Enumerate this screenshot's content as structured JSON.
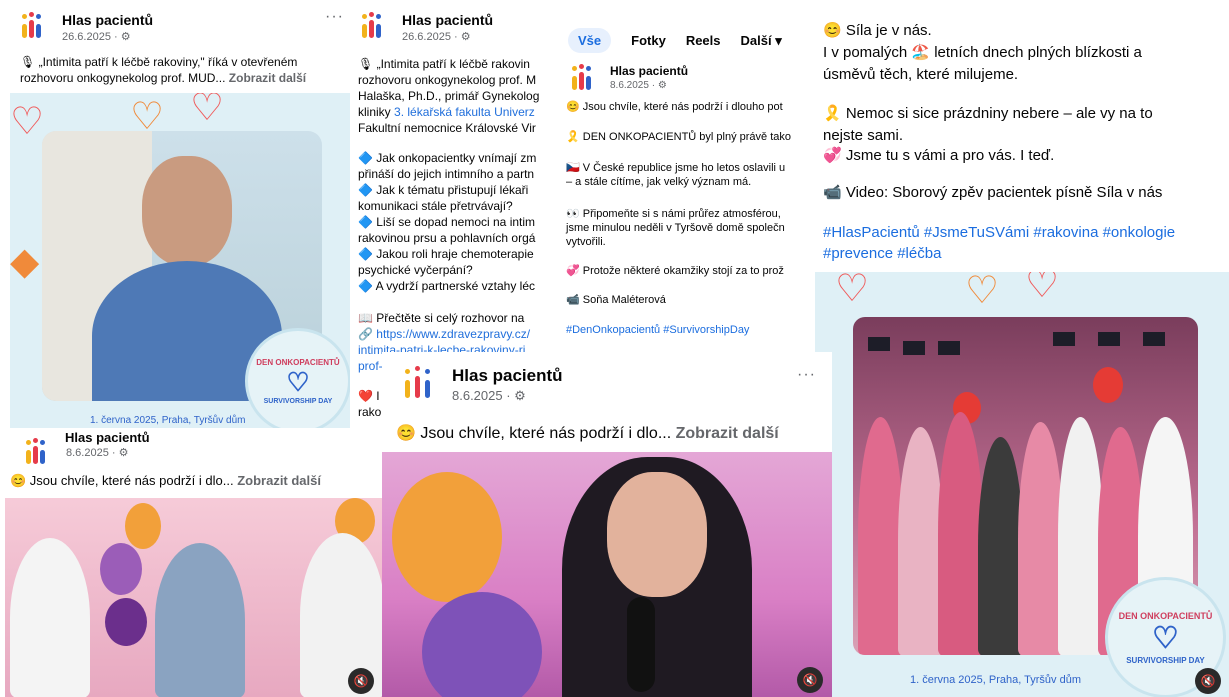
{
  "page_name": "Hlas pacientů",
  "posts": [
    {
      "date": "26.6.2025 · ⚙",
      "line1": "🎙 „Intimita patří k léčbě rakoviny,\" říká v otevřeném",
      "line2": "rozhovoru onkogynekolog prof. MUD...",
      "more": "Zobrazit další",
      "badge_top": "DEN ONKOPACIENTŮ",
      "badge_bottom": "SURVIVORSHIP DAY",
      "caption": "1. června 2025, Praha, Tyršův dům"
    },
    {
      "date": "26.6.2025 · ⚙",
      "lines": [
        "🎙 „Intimita patří k léčbě rakovin",
        "rozhovoru onkogynekolog prof. M",
        "Halaška, Ph.D., primář Gynekolog"
      ],
      "line4_prefix": "kliniky ",
      "line4_link": "3. lékařská fakulta Univerz",
      "line5": "Fakultní nemocnice Královské Vir",
      "bullets": [
        "🔷 Jak onkopacientky vnímají zm",
        "přináší do jejich intimního a partn",
        "🔷 Jak k tématu přistupují lékaři",
        "komunikaci stále přetrvávají?",
        "🔷 Liší se dopad nemoci na intim",
        "rakovinou prsu a pohlavních orgá",
        "🔷 Jakou roli hraje chemoterapie",
        "psychické vyčerpání?",
        "🔷 A vydrží partnerské vztahy léc"
      ],
      "read_more": "📖 Přečtěte si celý rozhovor na",
      "url1": "🔗 https://www.zdravezpravy.cz/",
      "url2": "intimita-patri-k-lecbe-rakoviny-ri",
      "url3": "prof-",
      "tail1": "❤️ I",
      "tail2": "rako",
      "tail3": "..."
    },
    {
      "tabs": [
        "Vše",
        "Fotky",
        "Reels",
        "Další ▾"
      ],
      "date": "8.6.2025 · ⚙",
      "lines": [
        "😊 Jsou chvíle, které nás podrží i dlouho pot",
        "🎗️ DEN ONKOPACIENTŮ byl plný právě tako",
        "🇨🇿 V České republice jsme ho letos oslavili u",
        "– a stále cítíme, jak velký význam má.",
        "👀 Připomeňte si s námi průřez atmosférou,",
        "jsme minulou neděli v Tyršově domě společn",
        "vytvořili.",
        "💞 Protože některé okamžiky stojí za to prož",
        "📹 Soňa Maléterová",
        "#DenOnkopacientů #SurvivorshipDay"
      ]
    },
    {
      "lines": [
        "😊 Síla je v nás.",
        "I v pomalých 🏖️ letních dnech plných blízkosti a",
        "úsměvů těch, které milujeme.",
        "🎗️ Nemoc si sice prázdniny nebere – ale vy na to",
        "nejste sami.",
        "💞 Jsme tu s vámi a pro vás. I teď.",
        "📹 Video: Sborový zpěv pacientek písně Síla v nás"
      ],
      "hashtags1": "#HlasPacientů #JsmeTuSVámi #rakovina #onkologie",
      "hashtags2": "#prevence #léčba",
      "badge_top": "DEN ONKOPACIENTŮ",
      "badge_bottom": "SURVIVORSHIP DAY",
      "caption": "1. června 2025, Praha, Tyršův dům"
    },
    {
      "date": "8.6.2025 · ⚙",
      "text": "😊 Jsou chvíle, které nás podrží i dlo...",
      "more": "Zobrazit další",
      "hidden_name": "Hlas pacientů"
    },
    {
      "date": "8.6.2025 · ⚙",
      "text": "😊 Jsou chvíle, které nás podrží i dlo...",
      "more": "Zobrazit další"
    }
  ],
  "icons": {
    "mute": "speaker-muted-icon",
    "more": "more-options-icon",
    "globe": "globe-icon"
  },
  "colors": {
    "brand_red": "#e63b4a",
    "brand_blue": "#2f63c9",
    "brand_yellow": "#f2b21b",
    "link": "#216fdb"
  }
}
